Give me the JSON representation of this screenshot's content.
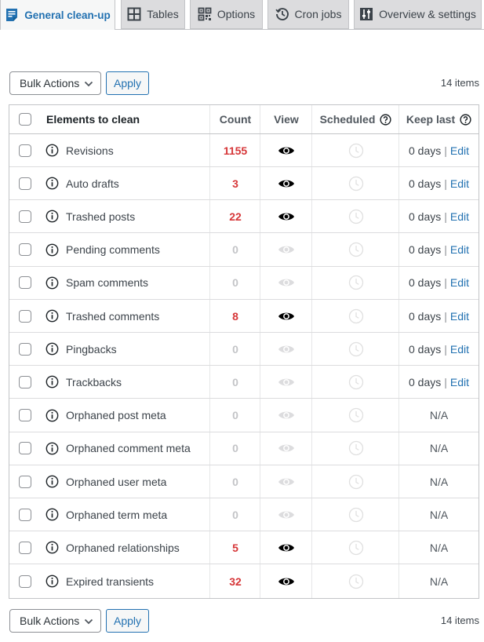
{
  "tabs": [
    {
      "label": "General clean-up",
      "icon": "document-lines-icon",
      "active": true
    },
    {
      "label": "Tables",
      "icon": "table-grid-icon",
      "active": false
    },
    {
      "label": "Options",
      "icon": "qr-options-icon",
      "active": false
    },
    {
      "label": "Cron jobs",
      "icon": "history-clock-icon",
      "active": false
    },
    {
      "label": "Overview & settings",
      "icon": "settings-sliders-icon",
      "active": false
    }
  ],
  "bulk": {
    "select_label": "Bulk Actions",
    "apply_label": "Apply",
    "items_count": "14 items"
  },
  "table": {
    "headers": {
      "elements": "Elements to clean",
      "count": "Count",
      "view": "View",
      "scheduled": "Scheduled",
      "keep_last": "Keep last"
    },
    "rows": [
      {
        "name": "Revisions",
        "count": "1155",
        "viewable": true,
        "keep": "0 days",
        "edit": "Edit"
      },
      {
        "name": "Auto drafts",
        "count": "3",
        "viewable": true,
        "keep": "0 days",
        "edit": "Edit"
      },
      {
        "name": "Trashed posts",
        "count": "22",
        "viewable": true,
        "keep": "0 days",
        "edit": "Edit"
      },
      {
        "name": "Pending comments",
        "count": "0",
        "viewable": false,
        "keep": "0 days",
        "edit": "Edit"
      },
      {
        "name": "Spam comments",
        "count": "0",
        "viewable": false,
        "keep": "0 days",
        "edit": "Edit"
      },
      {
        "name": "Trashed comments",
        "count": "8",
        "viewable": true,
        "keep": "0 days",
        "edit": "Edit"
      },
      {
        "name": "Pingbacks",
        "count": "0",
        "viewable": false,
        "keep": "0 days",
        "edit": "Edit"
      },
      {
        "name": "Trackbacks",
        "count": "0",
        "viewable": false,
        "keep": "0 days",
        "edit": "Edit"
      },
      {
        "name": "Orphaned post meta",
        "count": "0",
        "viewable": false,
        "keep": "N/A"
      },
      {
        "name": "Orphaned comment meta",
        "count": "0",
        "viewable": false,
        "keep": "N/A"
      },
      {
        "name": "Orphaned user meta",
        "count": "0",
        "viewable": false,
        "keep": "N/A"
      },
      {
        "name": "Orphaned term meta",
        "count": "0",
        "viewable": false,
        "keep": "N/A"
      },
      {
        "name": "Orphaned relationships",
        "count": "5",
        "viewable": true,
        "keep": "N/A"
      },
      {
        "name": "Expired transients",
        "count": "32",
        "viewable": true,
        "keep": "N/A"
      }
    ]
  },
  "colors": {
    "accent": "#2271b1",
    "count_positive": "#d63638",
    "count_zero": "#c3c4c7",
    "eye_active": "#000000",
    "eye_disabled": "#dcdcde",
    "clock_disabled": "#e0e0e0"
  }
}
